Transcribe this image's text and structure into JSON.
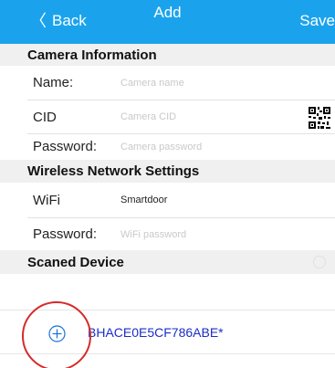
{
  "nav": {
    "back_label": "Back",
    "title": "Add",
    "save_label": "Save"
  },
  "sections": {
    "camera_info": "Camera Information",
    "wireless": "Wireless Network Settings",
    "scanned": "Scaned Device"
  },
  "camera": {
    "name_label": "Name:",
    "name_value": "",
    "name_placeholder": "Camera name",
    "cid_label": "CID",
    "cid_value": "",
    "cid_placeholder": "Camera CID",
    "password_label": "Password:",
    "password_value": "",
    "password_placeholder": "Camera password"
  },
  "wifi": {
    "ssid_label": "WiFi",
    "ssid_value": "Smartdoor",
    "password_label": "Password:",
    "password_value": "",
    "password_placeholder": "WiFi password"
  },
  "device": {
    "id": "BHACE0E5CF786ABE*"
  },
  "colors": {
    "navbar": "#1aa3ec",
    "section_bg": "#f0f0f0",
    "device_text": "#1b2dc7",
    "highlight": "#d62a2a"
  },
  "icons": {
    "qr": "qr-code-icon",
    "add": "plus-circle-icon",
    "back": "chevron-left-icon"
  }
}
